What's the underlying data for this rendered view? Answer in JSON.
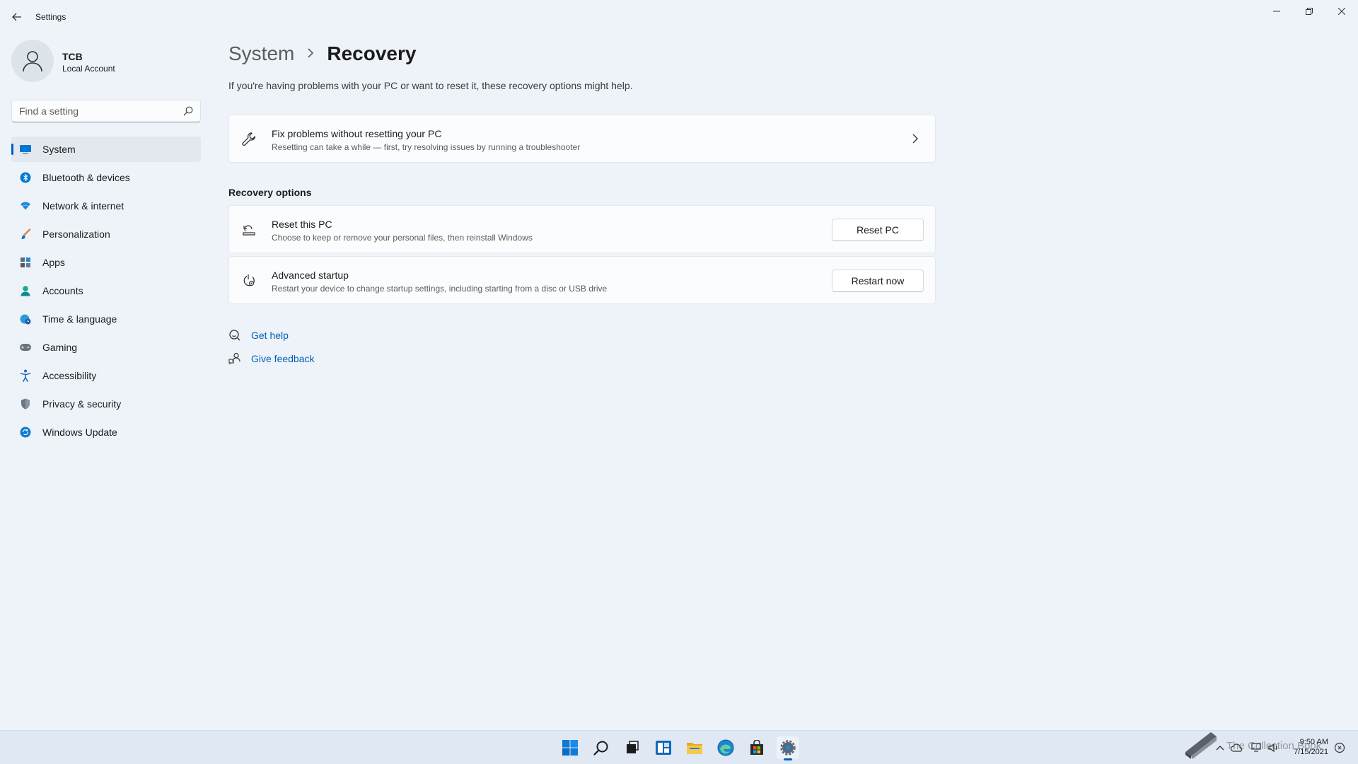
{
  "window": {
    "app_title": "Settings",
    "back_icon": "back-arrow-icon",
    "controls": [
      "minimize-icon",
      "restore-icon",
      "close-icon"
    ]
  },
  "profile": {
    "name": "TCB",
    "account_type": "Local Account"
  },
  "search": {
    "placeholder": "Find a setting",
    "value": ""
  },
  "sidebar": {
    "items": [
      {
        "label": "System",
        "icon": "monitor-icon",
        "active": true
      },
      {
        "label": "Bluetooth & devices",
        "icon": "bluetooth-icon"
      },
      {
        "label": "Network & internet",
        "icon": "wifi-icon"
      },
      {
        "label": "Personalization",
        "icon": "brush-icon"
      },
      {
        "label": "Apps",
        "icon": "apps-icon"
      },
      {
        "label": "Accounts",
        "icon": "person-icon"
      },
      {
        "label": "Time & language",
        "icon": "globe-clock-icon"
      },
      {
        "label": "Gaming",
        "icon": "gamepad-icon"
      },
      {
        "label": "Accessibility",
        "icon": "accessibility-icon"
      },
      {
        "label": "Privacy & security",
        "icon": "shield-icon"
      },
      {
        "label": "Windows Update",
        "icon": "update-icon"
      }
    ]
  },
  "main": {
    "breadcrumb_parent": "System",
    "breadcrumb_current": "Recovery",
    "intro": "If you're having problems with your PC or want to reset it, these recovery options might help.",
    "fix_card": {
      "title": "Fix problems without resetting your PC",
      "subtitle": "Resetting can take a while — first, try resolving issues by running a troubleshooter"
    },
    "section_title": "Recovery options",
    "reset_card": {
      "title": "Reset this PC",
      "subtitle": "Choose to keep or remove your personal files, then reinstall Windows",
      "button": "Reset PC"
    },
    "advanced_card": {
      "title": "Advanced startup",
      "subtitle": "Restart your device to change startup settings, including starting from a disc or USB drive",
      "button": "Restart now"
    },
    "links": {
      "help": "Get help",
      "feedback": "Give feedback"
    }
  },
  "taskbar": {
    "icons": [
      "start-icon",
      "search-icon",
      "task-view-icon",
      "widgets-icon",
      "file-explorer-icon",
      "edge-icon",
      "store-icon",
      "settings-icon"
    ],
    "time": "9:50 AM",
    "date": "7/15/2021",
    "watermark_text": "The Collection Book"
  },
  "colors": {
    "accent": "#005fb8",
    "background": "#eef3f9",
    "card": "#fbfcfe"
  }
}
